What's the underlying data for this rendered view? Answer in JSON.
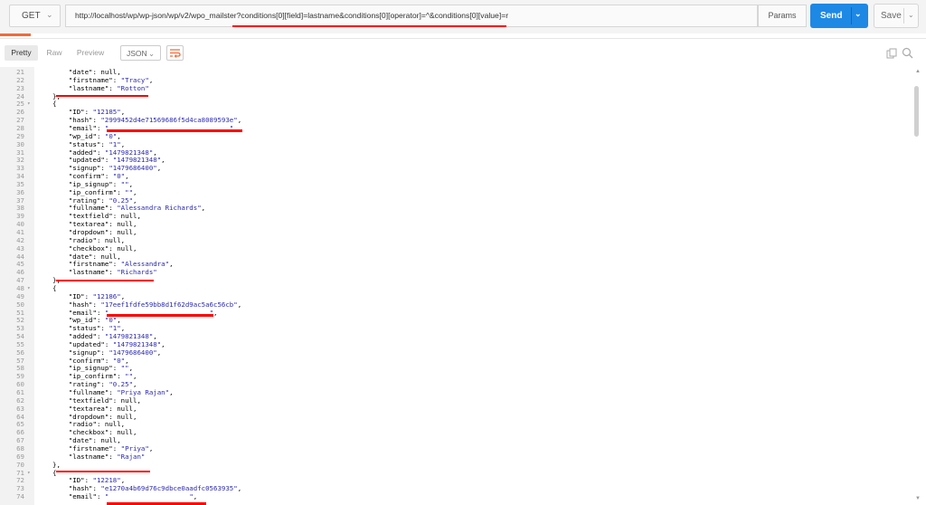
{
  "request": {
    "method": "GET",
    "url": "http://localhost/wp/wp-json/wp/v2/wpo_mailster?conditions[0][field]=lastname&conditions[0][operator]=^&conditions[0][value]=r",
    "params_label": "Params",
    "send_label": "Send",
    "save_label": "Save"
  },
  "response_toolbar": {
    "pretty": "Pretty",
    "raw": "Raw",
    "preview": "Preview",
    "format": "JSON"
  },
  "colors": {
    "send": "#1e88e5",
    "accent": "#f26b3a",
    "redaction": "#ff0000",
    "string": "#2a2ab0"
  },
  "lines": [
    {
      "n": 21,
      "text": "    \"date\": null,"
    },
    {
      "n": 22,
      "text": "    \"firstname\": \"Tracy\","
    },
    {
      "n": 23,
      "text": "    \"lastname\": \"Rotton\""
    },
    {
      "n": 24,
      "text": "},"
    },
    {
      "n": 25,
      "text": "{",
      "fold": true
    },
    {
      "n": 26,
      "text": "    \"ID\": \"12185\","
    },
    {
      "n": 27,
      "text": "    \"hash\": \"2999452d4e71569686f5d4ca8089593e\","
    },
    {
      "n": 28,
      "text": "    \"email\": \"                              \","
    },
    {
      "n": 29,
      "text": "    \"wp_id\": \"0\","
    },
    {
      "n": 30,
      "text": "    \"status\": \"1\","
    },
    {
      "n": 31,
      "text": "    \"added\": \"1479821348\","
    },
    {
      "n": 32,
      "text": "    \"updated\": \"1479821348\","
    },
    {
      "n": 33,
      "text": "    \"signup\": \"1479686400\","
    },
    {
      "n": 34,
      "text": "    \"confirm\": \"0\","
    },
    {
      "n": 35,
      "text": "    \"ip_signup\": \"\","
    },
    {
      "n": 36,
      "text": "    \"ip_confirm\": \"\","
    },
    {
      "n": 37,
      "text": "    \"rating\": \"0.25\","
    },
    {
      "n": 38,
      "text": "    \"fullname\": \"Alessandra Richards\","
    },
    {
      "n": 39,
      "text": "    \"textfield\": null,"
    },
    {
      "n": 40,
      "text": "    \"textarea\": null,"
    },
    {
      "n": 41,
      "text": "    \"dropdown\": null,"
    },
    {
      "n": 42,
      "text": "    \"radio\": null,"
    },
    {
      "n": 43,
      "text": "    \"checkbox\": null,"
    },
    {
      "n": 44,
      "text": "    \"date\": null,"
    },
    {
      "n": 45,
      "text": "    \"firstname\": \"Alessandra\","
    },
    {
      "n": 46,
      "text": "    \"lastname\": \"Richards\""
    },
    {
      "n": 47,
      "text": "},"
    },
    {
      "n": 48,
      "text": "{",
      "fold": true
    },
    {
      "n": 49,
      "text": "    \"ID\": \"12186\","
    },
    {
      "n": 50,
      "text": "    \"hash\": \"17eef1fdfe59bb8d1f62d9ac5a6c56cb\","
    },
    {
      "n": 51,
      "text": "    \"email\": \"                         \","
    },
    {
      "n": 52,
      "text": "    \"wp_id\": \"0\","
    },
    {
      "n": 53,
      "text": "    \"status\": \"1\","
    },
    {
      "n": 54,
      "text": "    \"added\": \"1479821348\","
    },
    {
      "n": 55,
      "text": "    \"updated\": \"1479821348\","
    },
    {
      "n": 56,
      "text": "    \"signup\": \"1479686400\","
    },
    {
      "n": 57,
      "text": "    \"confirm\": \"0\","
    },
    {
      "n": 58,
      "text": "    \"ip_signup\": \"\","
    },
    {
      "n": 59,
      "text": "    \"ip_confirm\": \"\","
    },
    {
      "n": 60,
      "text": "    \"rating\": \"0.25\","
    },
    {
      "n": 61,
      "text": "    \"fullname\": \"Priya Rajan\","
    },
    {
      "n": 62,
      "text": "    \"textfield\": null,"
    },
    {
      "n": 63,
      "text": "    \"textarea\": null,"
    },
    {
      "n": 64,
      "text": "    \"dropdown\": null,"
    },
    {
      "n": 65,
      "text": "    \"radio\": null,"
    },
    {
      "n": 66,
      "text": "    \"checkbox\": null,"
    },
    {
      "n": 67,
      "text": "    \"date\": null,"
    },
    {
      "n": 68,
      "text": "    \"firstname\": \"Priya\","
    },
    {
      "n": 69,
      "text": "    \"lastname\": \"Rajan\""
    },
    {
      "n": 70,
      "text": "},"
    },
    {
      "n": 71,
      "text": "{",
      "fold": true
    },
    {
      "n": 72,
      "text": "    \"ID\": \"12218\","
    },
    {
      "n": 73,
      "text": "    \"hash\": \"e1270a4b69d76c9dbce0aadfc0563935\","
    },
    {
      "n": 74,
      "text": "    \"email\": \"                    \","
    }
  ]
}
